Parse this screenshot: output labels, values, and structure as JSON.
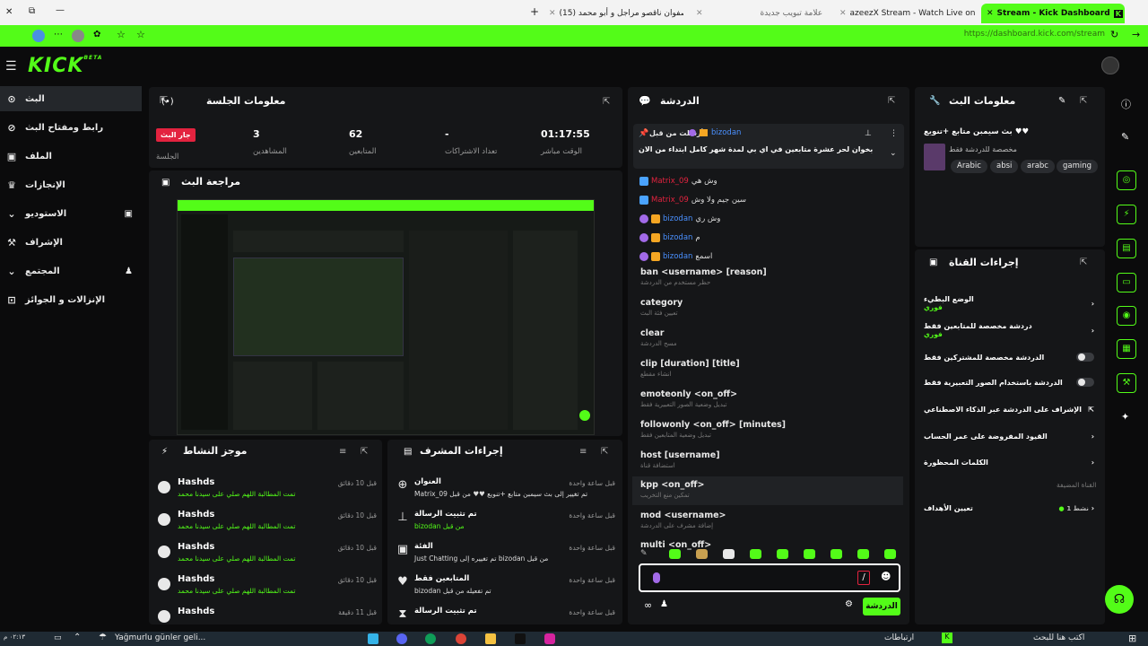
{
  "browser": {
    "tabs": [
      {
        "label": "(15) صفوان ناقصو مراجل و أبو محمد",
        "active": false
      },
      {
        "label": "علامة تبويب جديدة",
        "active": false
      },
      {
        "label": "azeezX Stream - Watch Live on",
        "active": false
      },
      {
        "label": "Stream - Kick Dashboard",
        "active": true
      }
    ],
    "url": "https://dashboard.kick.com/stream"
  },
  "header": {
    "logo": "KICK",
    "logo_tag": "BETA"
  },
  "sidebar": {
    "items": [
      {
        "label": "البث",
        "icon": "broadcast-icon",
        "active": true
      },
      {
        "label": "رابط ومفتاح البث",
        "icon": "link-icon"
      },
      {
        "label": "الملف",
        "icon": "profile-icon"
      },
      {
        "label": "الإنجازات",
        "icon": "trophy-icon"
      },
      {
        "label": "الاستوديو",
        "icon": "studio-icon"
      },
      {
        "label": "الإشراف",
        "icon": "gavel-icon"
      },
      {
        "label": "المجتمع",
        "icon": "community-icon"
      },
      {
        "label": "الإنزالات و الجوائز",
        "icon": "gift-icon"
      }
    ]
  },
  "session": {
    "title": "معلومات الجلسة",
    "live_label": "جار البث",
    "session_label": "الجلسة",
    "stats": [
      {
        "value": "3",
        "label": "المشاهدين"
      },
      {
        "value": "62",
        "label": "المتابعين"
      },
      {
        "value": "-",
        "label": "تعداد الاشتراكات"
      },
      {
        "value": "01:17:55",
        "label": "الوقت مباشر"
      }
    ]
  },
  "preview": {
    "title": "مراجعة البث"
  },
  "chat": {
    "title": "الدردشة",
    "pinned": {
      "by_label": "أرسلت من قبل",
      "user": "bizodan",
      "text": "بخوان لحر عشرة متابعين في اي بي لمدة شهر كامل ابتداء من الان"
    },
    "messages": [
      {
        "user": "Matrix_09",
        "user_color": "#e3233f",
        "text": "وش هي"
      },
      {
        "user": "Matrix_09",
        "user_color": "#e3233f",
        "text": "سين جيم ولا وش"
      },
      {
        "user": "bizodan",
        "user_color": "#4a90ff",
        "text": "وش ري"
      },
      {
        "user": "bizodan",
        "user_color": "#4a90ff",
        "text": "م"
      },
      {
        "user": "bizodan",
        "user_color": "#4a90ff",
        "text": "اسمع"
      }
    ],
    "commands": [
      {
        "name": "ban <username> [reason]",
        "desc": "حظر مستخدم من الدردشة"
      },
      {
        "name": "category",
        "desc": "تعيين فئة البث"
      },
      {
        "name": "clear",
        "desc": "مسح الدردشة"
      },
      {
        "name": "clip [duration] [title]",
        "desc": "انشاء مقطع"
      },
      {
        "name": "emoteonly <on_off>",
        "desc": "تبديل وضعية الصور التعبيرية فقط"
      },
      {
        "name": "followonly <on_off> [minutes]",
        "desc": "تبديل وضعية المتابعين فقط"
      },
      {
        "name": "host [username]",
        "desc": "استضافة قناة"
      },
      {
        "name": "kpp <on_off>",
        "desc": "تمكين منع التخريب"
      },
      {
        "name": "mod <username>",
        "desc": "إضافة مشرف على الدردشة"
      },
      {
        "name": "multi <on_off>",
        "desc": ""
      }
    ],
    "input_value": "/",
    "send_label": "الدردشة"
  },
  "stream_info": {
    "title": "معلومات البث",
    "stream_title": "بث سيمبن متابع +تنويع ♥♥",
    "category": "مخصصة للدردشة فقط",
    "tags": [
      "Arabic",
      "absi",
      "arabc",
      "gaming"
    ]
  },
  "channel_actions": {
    "title": "إجراءات القناة",
    "rows": [
      {
        "label": "الوضع البطيء",
        "sub": "فوري",
        "control": "chevron"
      },
      {
        "label": "دردشة مخصصة للمتابعين فقط",
        "sub": "فوري",
        "control": "chevron"
      },
      {
        "label": "الدردشة مخصصة للمشتركين فقط",
        "sub": "",
        "control": "toggle"
      },
      {
        "label": "الدردشة باستخدام الصور التعبيرية فقط",
        "sub": "",
        "control": "toggle"
      },
      {
        "label": "الإشراف على الدردشة عبر الذكاء الاصطناعي",
        "sub": "",
        "control": "external"
      },
      {
        "label": "القيود المفروضة على عمر الحساب",
        "sub": "",
        "control": "chevron"
      },
      {
        "label": "الكلمات المحظورة",
        "sub": "",
        "control": "chevron"
      }
    ],
    "section_label": "القناة المضيفة",
    "host_target": "تعيين الأهداف",
    "host_status": "1 نشط"
  },
  "activity": {
    "title": "موجز النشاط",
    "items": [
      {
        "user": "Hashds",
        "text": "تمت المطالبة اللهم صلي على سيدنا محمد",
        "time": "قبل 10 دقائق"
      },
      {
        "user": "Hashds",
        "text": "تمت المطالبة اللهم صلي على سيدنا محمد",
        "time": "قبل 10 دقائق"
      },
      {
        "user": "Hashds",
        "text": "تمت المطالبة اللهم صلي على سيدنا محمد",
        "time": "قبل 10 دقائق"
      },
      {
        "user": "Hashds",
        "text": "تمت المطالبة اللهم صلي على سيدنا محمد",
        "time": "قبل 10 دقائق"
      },
      {
        "user": "Hashds",
        "text": "",
        "time": "قبل 11 دقيقة"
      }
    ]
  },
  "mod_actions": {
    "title": "إجراءات المشرف",
    "items": [
      {
        "title": "العنوان",
        "text": "Matrix_09 تم تغيير إلى بث سيمبن متابع +تنويع ♥♥ من قبل",
        "time": "قبل ساعة واحدة",
        "icon": "title-icon"
      },
      {
        "title": "تم تثبيت الرسالة",
        "text": "bizodan من قبل",
        "time": "قبل ساعة واحدة",
        "icon": "pin-icon"
      },
      {
        "title": "الفئة",
        "text": "Just Chatting تم تغييره إلى bizodan من قبل",
        "time": "قبل ساعة واحدة",
        "icon": "category-icon"
      },
      {
        "title": "المتابعين فقط",
        "text": "bizodan تم تفعيله من قبل",
        "time": "قبل ساعة واحدة",
        "icon": "heart-icon"
      },
      {
        "title": "تم تثبيت الرسالة",
        "text": "",
        "time": "قبل ساعة واحدة",
        "icon": "hourglass-icon"
      }
    ]
  },
  "taskbar": {
    "weather": "Yağmurlu günler geli...",
    "search": "اكتب هنا للبحث",
    "tray": "ارتباطات",
    "clock": "٠٢:١٣ م"
  }
}
